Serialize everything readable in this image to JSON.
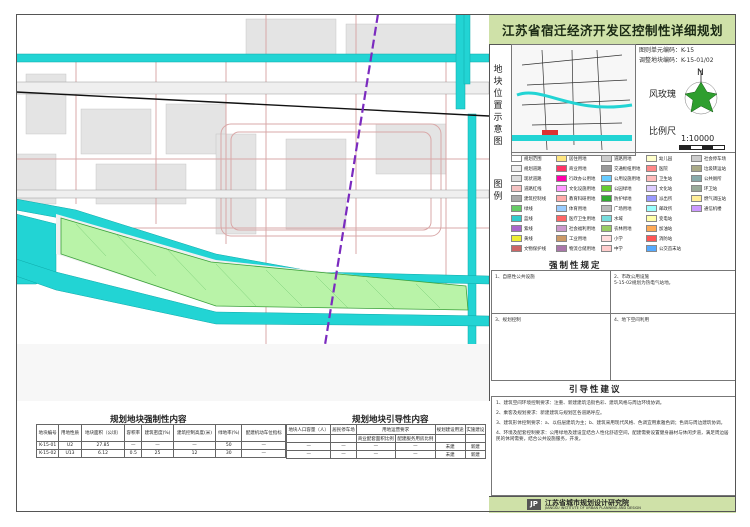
{
  "title": "江苏省宿迁经济开发区控制性详细规划",
  "plan_unit_code": "图则单元编码：K-15",
  "adjust_block_code": "调整地块编码：K-15-01/02",
  "location_label": "地块位置示意图",
  "wind_rose_label": "风玫瑰",
  "scale_label": "比例尺",
  "scale_value": "1:10000",
  "north_label": "N",
  "legend_label": "图例",
  "legend_items": [
    "规划范围",
    "规划道路",
    "现状道路",
    "道路红线",
    "建筑控制线",
    "绿线",
    "蓝线",
    "紫线",
    "黄线",
    "文物保护线",
    "居住用地",
    "商业用地",
    "行政办公用地",
    "文化设施用地",
    "教育科研用地",
    "体育用地",
    "医疗卫生用地",
    "社会福利用地",
    "工业用地",
    "物流仓储用地",
    "道路用地",
    "交通枢纽用地",
    "公用设施用地",
    "公园绿地",
    "防护绿地",
    "广场用地",
    "水域",
    "农林用地",
    "小学",
    "中学",
    "幼儿园",
    "医院",
    "卫生站",
    "文化站",
    "派出所",
    "邮政所",
    "变电站",
    "加油站",
    "消防站",
    "公交首末站",
    "社会停车场",
    "垃圾转运站",
    "公共厕所",
    "环卫站",
    "燃气调压站",
    "通信机楼"
  ],
  "mandatory_title": "强制性规定",
  "mandatory_cells": [
    "1、自愿性公共设施",
    "2、市政公用设施\n5-15-02规划为热电气站地。",
    "3、规划控制",
    "4、地下空间利用"
  ],
  "guidance_title": "引导性建议",
  "guidance_lines": [
    "1、建筑空间环境控制要求：注重、新建建筑沿街色彩、建筑风格与周边环境协调。",
    "2、乘客及规划要求：新建建筑与规划区各道路呼应。",
    "3、建筑形体控制要求：a、以低层建筑为主；b、建筑采用现代风格、色调宜用素雅色调；色调与周边建筑协调。",
    "4、环境及配套控制要求：公用绿地及建设宜结合人性化舒适空间，配建需要设置健身器材与休闲步道，满足周边居民的休闲需要，结合公共设施服务，开发。"
  ],
  "table1_title": "规划地块强制性内容",
  "table1_headers": [
    "地块编号",
    "用地性质",
    "地块面积（公顷）",
    "容积率",
    "建筑密度(%)",
    "建筑控制高度(米)",
    "绿地率(%)",
    "配建机动车位指标"
  ],
  "table1_rows": [
    [
      "K-15-01",
      "U2",
      "27.85",
      "—",
      "—",
      "—",
      "50",
      "—"
    ],
    [
      "K-15-02",
      "U13",
      "6.12",
      "0.5",
      "25",
      "12",
      "30",
      "—"
    ]
  ],
  "table2_title": "规划地块引导性内容",
  "table2_headers": [
    "地块人口容量（人）",
    "居民停车场",
    "用地运营要求",
    "规划建设用途",
    "实施建设"
  ],
  "table2_sub": [
    "商业配套面积比例",
    "配建服务用房比例"
  ],
  "table2_rows": [
    [
      "—",
      "—",
      "—",
      "—",
      "未建",
      "新建"
    ],
    [
      "—",
      "—",
      "—",
      "—",
      "未建",
      "新建"
    ]
  ],
  "institute_name": "江苏省城市规划设计研究院",
  "institute_name_en": "JIANGSU INSTITUTE OF URBAN PLANNING AND DESIGN",
  "colors": {
    "river": "#22d4d4",
    "green_area": "#b9f3a8",
    "title_bg": "#cfe1a8",
    "boundary_purple": "#7b2bbf",
    "road_red": "#d7a0a0"
  }
}
